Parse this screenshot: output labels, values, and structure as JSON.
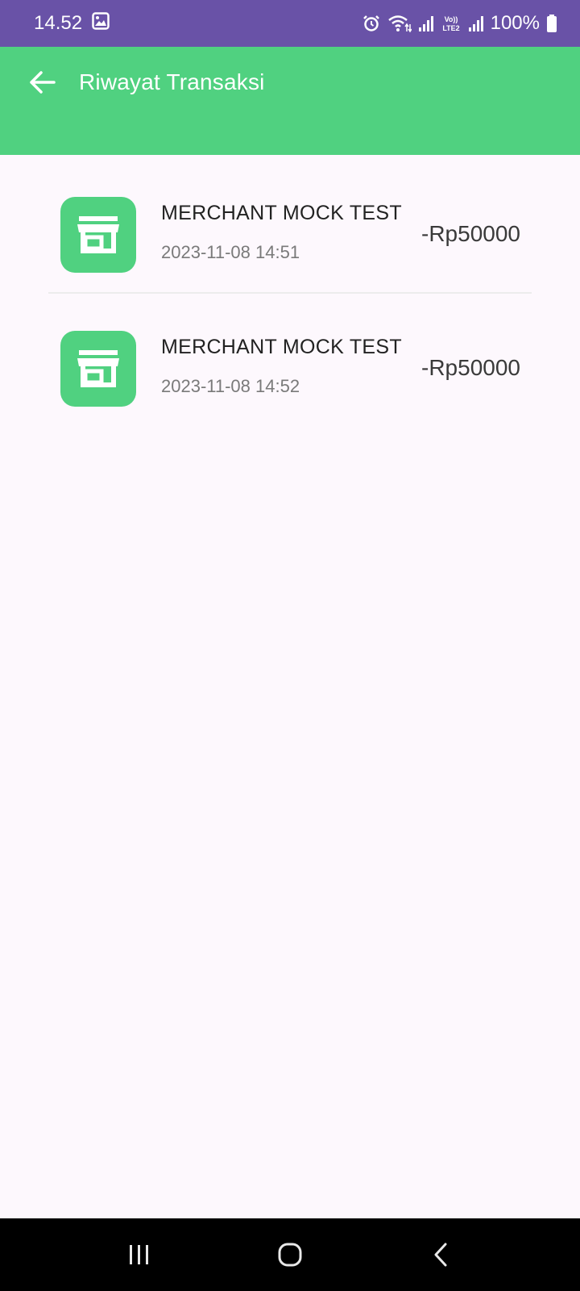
{
  "status_bar": {
    "time": "14.52",
    "battery": "100%",
    "icons": [
      "gallery-icon",
      "alarm-icon",
      "wifi-icon",
      "signal-icon",
      "volte-lte2-icon",
      "signal-icon",
      "battery-icon"
    ]
  },
  "app_bar": {
    "title": "Riwayat Transaksi",
    "back_icon": "arrow-left-icon"
  },
  "transactions": [
    {
      "name": "MERCHANT MOCK TEST",
      "date": "2023-11-08 14:51",
      "amount": "-Rp50000",
      "icon": "store-icon"
    },
    {
      "name": "MERCHANT MOCK TEST",
      "date": "2023-11-08 14:52",
      "amount": "-Rp50000",
      "icon": "store-icon"
    }
  ],
  "nav_bar": {
    "buttons": [
      "recent-apps-icon",
      "home-icon",
      "back-icon"
    ]
  },
  "colors": {
    "status_bar": "#6952a7",
    "accent": "#50d180",
    "background": "#fdf8fd"
  }
}
